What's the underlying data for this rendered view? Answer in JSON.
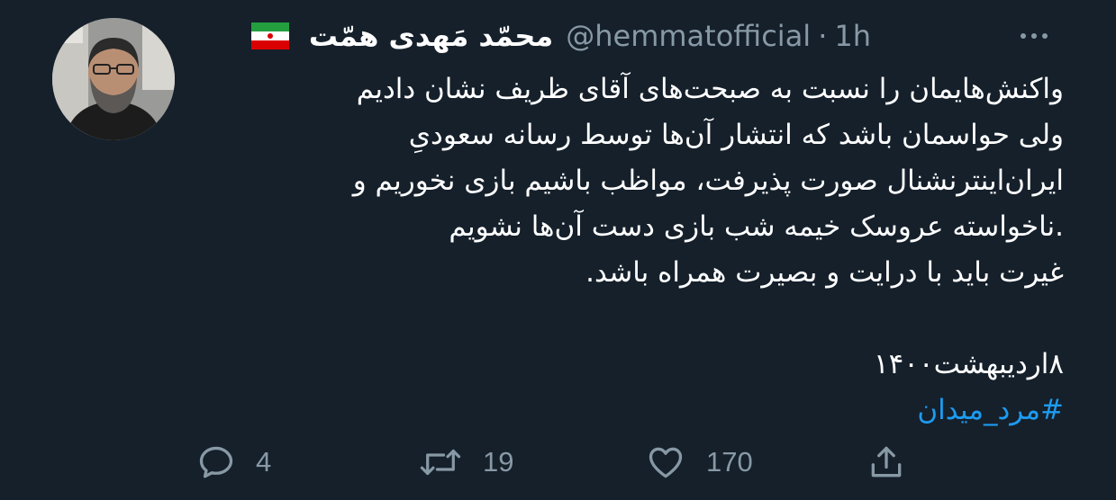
{
  "tweet": {
    "author": {
      "display_name": "محمّد مَهدی همّت",
      "handle": "@hemmatofficial",
      "separator": "·",
      "time": "1h",
      "flag_icon": "iran-flag-icon",
      "avatar": "avatar"
    },
    "more_icon": "more-options-icon",
    "text_lines": [
      "واکنش‌هایمان را نسبت به صبحت‌های آقای ظریف نشان دادیم",
      "ولی حواسمان باشد که انتشار آن‌ها توسط رسانه سعودیِ",
      "ایران‌اینترنشنال صورت پذیرفت، مواظب باشیم بازی نخوریم و",
      ".ناخواسته عروسک خیمه شب بازی دست آن‌ها نشویم",
      "غیرت باید با درایت و بصیرت همراه باشد."
    ],
    "date_text": "۸اردیبهشت۱۴۰۰",
    "hashtag": "#مرد_میدان",
    "actions": {
      "reply": {
        "icon": "reply-icon",
        "count": "4"
      },
      "retweet": {
        "icon": "retweet-icon",
        "count": "19"
      },
      "like": {
        "icon": "heart-icon",
        "count": "170"
      },
      "share": {
        "icon": "share-icon"
      }
    },
    "colors": {
      "background": "#15202b",
      "text": "#ffffff",
      "secondary": "#8899a6",
      "link": "#1d9bf0"
    }
  }
}
